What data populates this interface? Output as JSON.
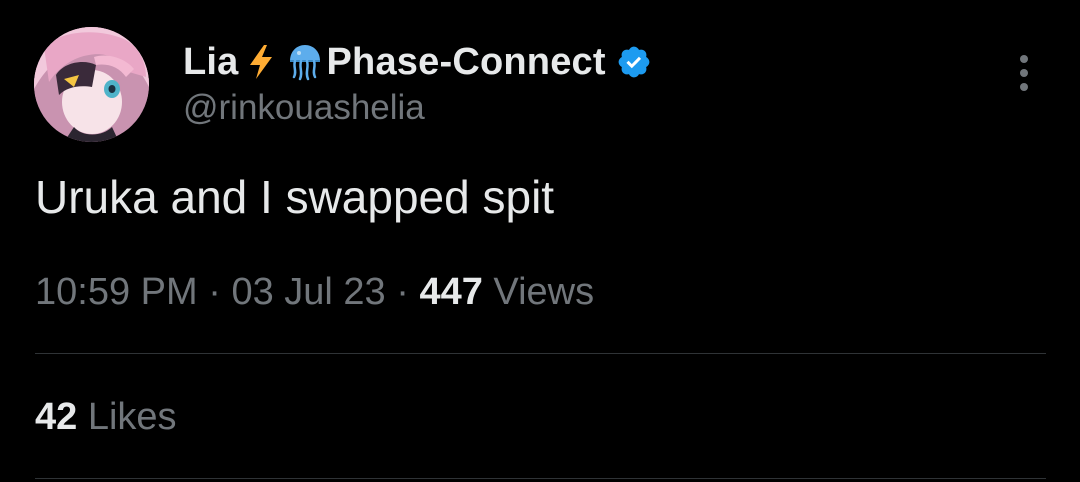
{
  "author": {
    "avatar_icon": "avatar-image",
    "display_name": "Lia",
    "emoji_1": "lightning-emoji",
    "emoji_2": "jellyfish-emoji",
    "affiliation": "Phase-Connect",
    "verified": true,
    "handle": "@rinkouashelia"
  },
  "tweet": {
    "text": "Uruka and I swapped spit",
    "time": "10:59 PM",
    "separator": "·",
    "date": "03 Jul 23",
    "views_count": "447",
    "views_label": "Views",
    "likes_count": "42",
    "likes_label": "Likes"
  },
  "colors": {
    "background": "#000000",
    "primary_text": "#e7e9ea",
    "secondary_text": "#71767b",
    "verified_blue": "#1d9bf0",
    "divider": "#2f3336"
  }
}
